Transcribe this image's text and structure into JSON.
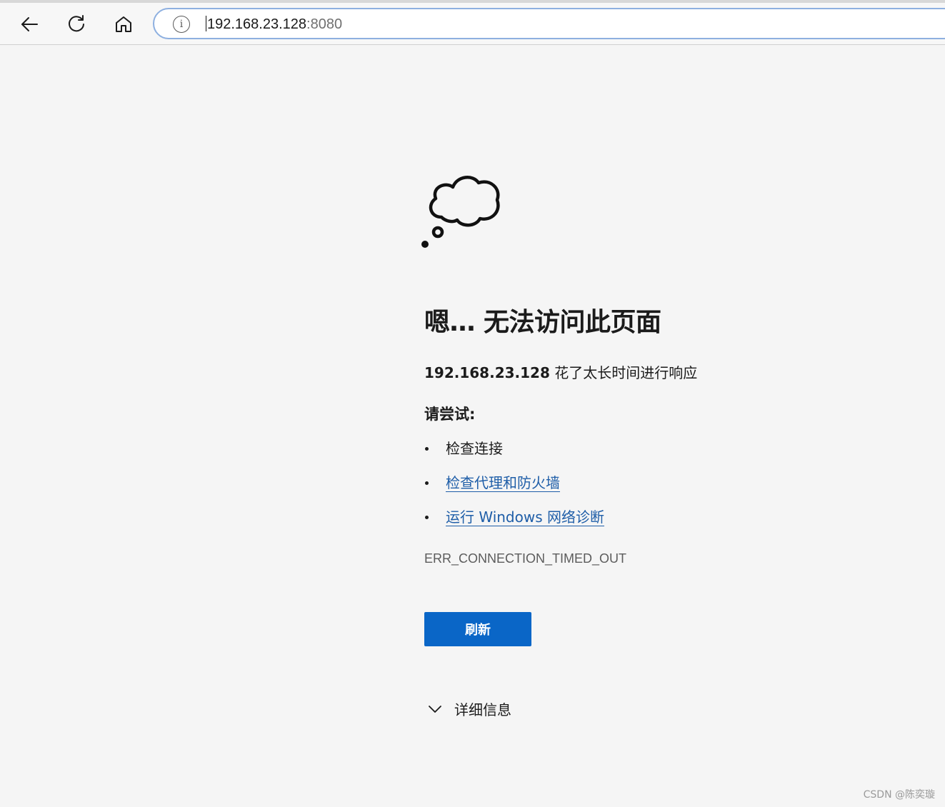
{
  "browser": {
    "url_host": "192.168.23.128",
    "url_port": ":8080",
    "site_info_icon": "info-icon"
  },
  "error_page": {
    "heading": "嗯… 无法访问此页面",
    "host": "192.168.23.128",
    "description": " 花了太长时间进行响应",
    "try_label": "请尝试:",
    "suggestions": [
      {
        "label": "检查连接",
        "is_link": false
      },
      {
        "label": "检查代理和防火墙",
        "is_link": true
      },
      {
        "label": "运行 Windows 网络诊断",
        "is_link": true
      }
    ],
    "error_code": "ERR_CONNECTION_TIMED_OUT",
    "reload_label": "刷新",
    "details_label": "详细信息"
  },
  "watermark": "CSDN @陈奕璇",
  "colors": {
    "accent": "#0a66c7",
    "link": "#1f5ea8",
    "page_bg": "#f5f5f5"
  }
}
